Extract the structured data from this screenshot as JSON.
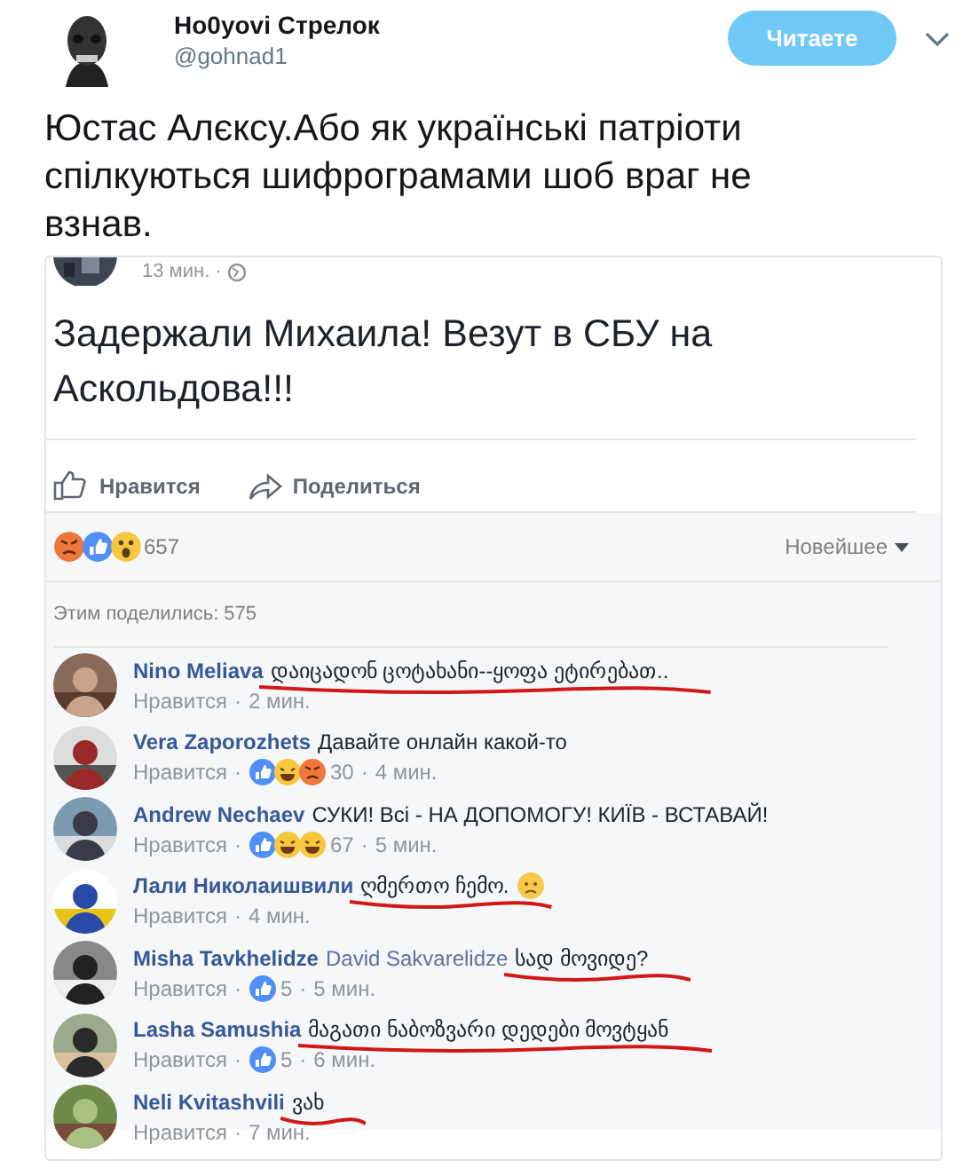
{
  "tweet": {
    "author": "Ho0yovi Стрелок",
    "handle": "@gohnad1",
    "follow_button": "Читаете",
    "text": "Юстас Алєксу.Або як українські патріоти спілкуються шифрограмами шоб враг не взнав."
  },
  "post": {
    "time": "13 мин. ·",
    "text": "Задержали Михаила! Везут в СБУ на Аскольдова!!!",
    "actions": [
      {
        "kind": "like",
        "label": "Нравится"
      },
      {
        "kind": "share",
        "label": "Поделиться"
      }
    ],
    "reactions": [
      {
        "kind": "angry"
      },
      {
        "kind": "like"
      },
      {
        "kind": "wow"
      }
    ],
    "reaction_count": "657",
    "sort": "Новейшее",
    "shares": "Этим поделились: 575",
    "comments": [
      {
        "name": "Nino Meliava",
        "text": "დაიცადონ ცოტახანი--ყოფა ეტირებათ..",
        "like": "Нравится",
        "separators": [
          "·"
        ],
        "time": "2 мин.",
        "underlined": true
      },
      {
        "name": "Vera Zaporozhets",
        "text": "Давайте онлайн какой-то",
        "like": "Нравится",
        "reactions": [
          {
            "kind": "like"
          },
          {
            "kind": "haha"
          },
          {
            "kind": "angry"
          }
        ],
        "count": "30",
        "separators": [
          "·",
          "·"
        ],
        "time": "4 мин.",
        "underlined": false
      },
      {
        "name": "Andrew Nechaev",
        "text": "СУКИ! Всі - НА ДОПОМОГУ! КИЇВ - ВСТАВАЙ!",
        "like": "Нравится",
        "reactions": [
          {
            "kind": "like"
          },
          {
            "kind": "haha"
          },
          {
            "kind": "haha"
          }
        ],
        "count": "67",
        "separators": [
          "·",
          "·"
        ],
        "time": "5 мин.",
        "underlined": false
      },
      {
        "name": "Лали Николаишвили",
        "text": "ღმერთო ჩემო.",
        "emoji": {
          "kind": "sad"
        },
        "like": "Нравится",
        "separators": [
          "·"
        ],
        "time": "4 мин.",
        "underlined": true
      },
      {
        "name": "Misha Tavkhelidze",
        "mention": "David Sakvarelidze",
        "text": "სად მოვიდე?",
        "like": "Нравится",
        "reactions": [
          {
            "kind": "like"
          }
        ],
        "count": "5",
        "separators": [
          "·",
          "·"
        ],
        "time": "5 мин.",
        "underlined": true
      },
      {
        "name": "Lasha Samushia",
        "text": "მაგათი ნაბოზვარი დედები მოვტყან",
        "like": "Нравится",
        "reactions": [
          {
            "kind": "like"
          }
        ],
        "count": "5",
        "separators": [
          "·",
          "·"
        ],
        "time": "6 мин.",
        "underlined": true
      },
      {
        "name": "Neli Kvitashvili",
        "text": "ვახ",
        "like": "Нравится",
        "separators": [
          "·"
        ],
        "time": "7 мин.",
        "underlined": true
      }
    ]
  }
}
